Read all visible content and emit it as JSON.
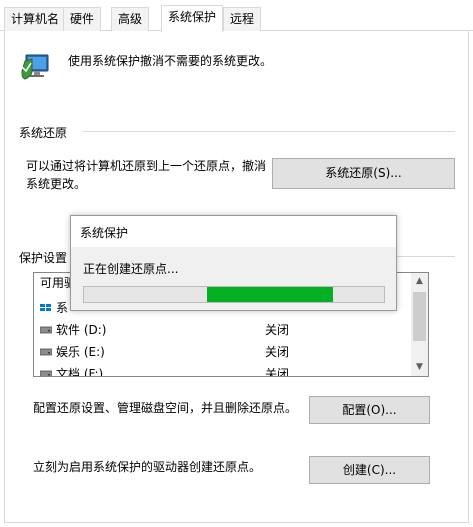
{
  "tabs": [
    {
      "label": "计算机名",
      "active": false
    },
    {
      "label": "硬件",
      "active": false
    },
    {
      "label": "高级",
      "active": false
    },
    {
      "label": "系统保护",
      "active": true
    },
    {
      "label": "远程",
      "active": false
    }
  ],
  "header": {
    "description": "使用系统保护撤消不需要的系统更改。",
    "icon": "computer-shield-icon"
  },
  "restore": {
    "group_label": "系统还原",
    "text_line1": "可以通过将计算机还原到上一个还原点，撤消",
    "text_line2": "系统更改。",
    "button_label": "系统还原(S)..."
  },
  "protection": {
    "group_label": "保护设置",
    "list_header": "可用驱",
    "drives": [
      {
        "name": "系",
        "state": ""
      },
      {
        "name": "软件 (D:)",
        "state": "关闭"
      },
      {
        "name": "娱乐 (E:)",
        "state": "关闭"
      },
      {
        "name": "文档 (F:)",
        "state": "关闭"
      }
    ]
  },
  "configure": {
    "text": "配置还原设置、管理磁盘空间，并且删除还原点。",
    "button_label": "配置(O)..."
  },
  "create": {
    "text": "立刻为启用系统保护的驱动器创建还原点。",
    "button_label": "创建(C)..."
  },
  "dialog": {
    "title": "系统保护",
    "message": "正在创建还原点...",
    "progress_start": 0.41,
    "progress_end": 0.83
  },
  "colors": {
    "progress_fill": "#06b025",
    "border": "#d9d9d9"
  }
}
